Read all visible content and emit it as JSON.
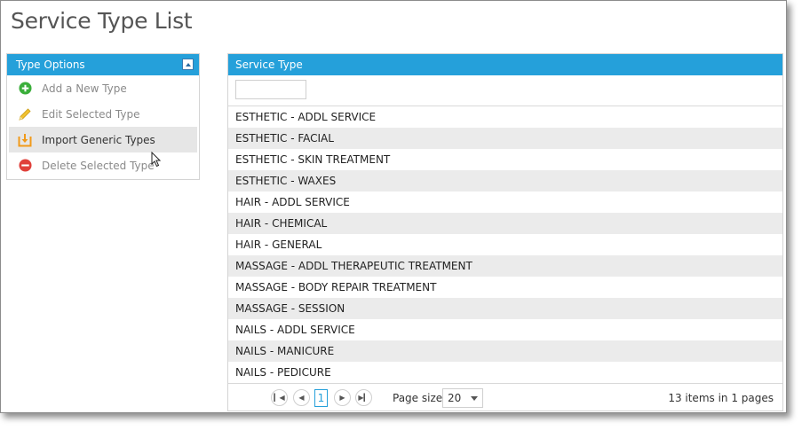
{
  "page": {
    "title": "Service Type List"
  },
  "type_options": {
    "header": "Type Options",
    "items": [
      {
        "label": "Add a New Type",
        "icon": "add-icon"
      },
      {
        "label": "Edit Selected Type",
        "icon": "pencil-icon"
      },
      {
        "label": "Import Generic Types",
        "icon": "import-icon"
      },
      {
        "label": "Delete Selected Type",
        "icon": "delete-icon"
      }
    ]
  },
  "grid": {
    "column_header": "Service Type",
    "filter_value": "",
    "rows": [
      "ESTHETIC - ADDL SERVICE",
      "ESTHETIC - FACIAL",
      "ESTHETIC - SKIN TREATMENT",
      "ESTHETIC - WAXES",
      "HAIR - ADDL SERVICE",
      "HAIR - CHEMICAL",
      "HAIR - GENERAL",
      "MASSAGE - ADDL THERAPEUTIC TREATMENT",
      "MASSAGE - BODY REPAIR TREATMENT",
      "MASSAGE - SESSION",
      "NAILS - ADDL SERVICE",
      "NAILS - MANICURE",
      "NAILS - PEDICURE"
    ]
  },
  "pager": {
    "current_page": "1",
    "page_size_label": "Page size:",
    "page_size": "20",
    "info": "13 items in 1 pages"
  },
  "colors": {
    "accent": "#25a0da",
    "alt_row": "#ebebeb"
  }
}
